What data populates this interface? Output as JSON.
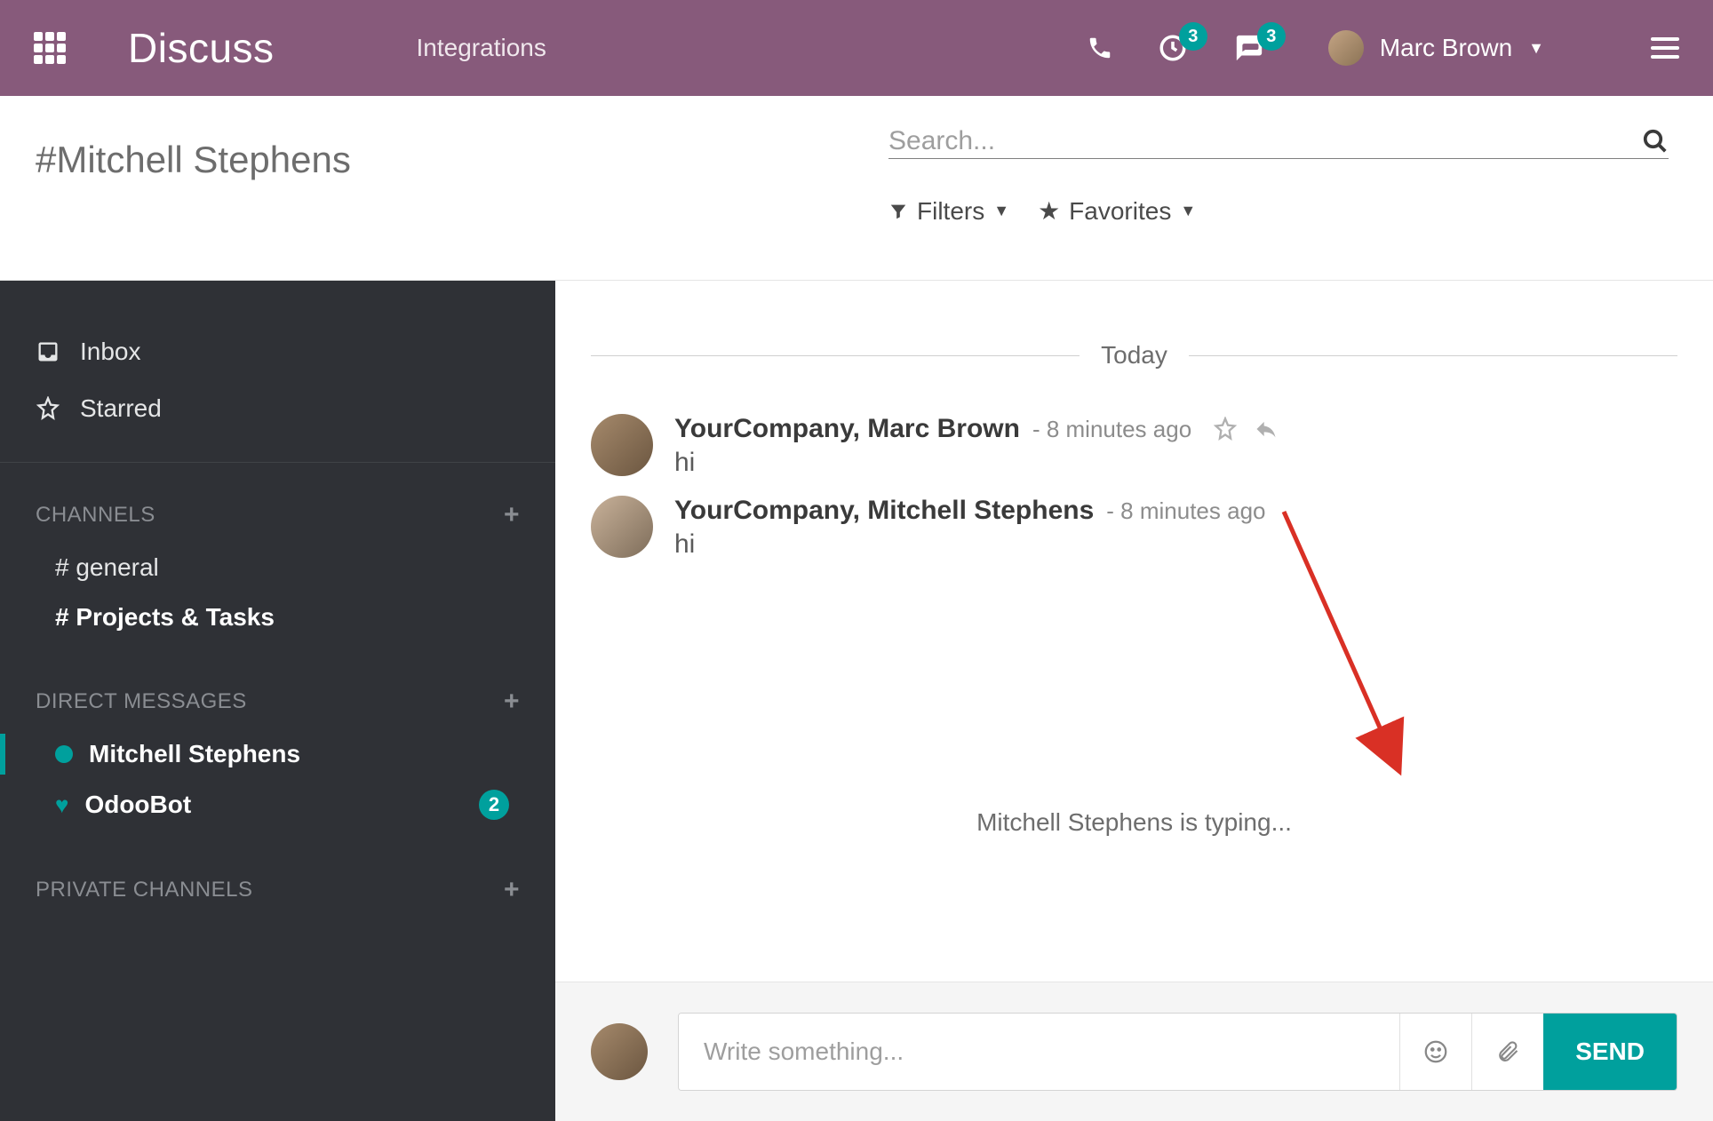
{
  "topbar": {
    "brand": "Discuss",
    "nav": {
      "integrations": "Integrations"
    },
    "activity_badge": "3",
    "messages_badge": "3",
    "user_name": "Marc Brown"
  },
  "subheader": {
    "channel_title": "#Mitchell Stephens",
    "search_placeholder": "Search...",
    "filters_label": "Filters",
    "favorites_label": "Favorites"
  },
  "sidebar": {
    "inbox": "Inbox",
    "starred": "Starred",
    "channels_header": "CHANNELS",
    "channels": [
      {
        "label": "# general",
        "bold": false
      },
      {
        "label": "# Projects & Tasks",
        "bold": true
      }
    ],
    "dm_header": "DIRECT MESSAGES",
    "dms": [
      {
        "label": "Mitchell Stephens",
        "badge": "",
        "icon": "dot",
        "active": true
      },
      {
        "label": "OdooBot",
        "badge": "2",
        "icon": "heart",
        "active": false
      }
    ],
    "private_header": "PRIVATE CHANNELS"
  },
  "thread": {
    "day_separator": "Today",
    "messages": [
      {
        "author": "YourCompany, Marc Brown",
        "time": "8 minutes ago",
        "body": "hi",
        "show_actions": true
      },
      {
        "author": "YourCompany, Mitchell Stephens",
        "time": "8 minutes ago",
        "body": "hi",
        "show_actions": false
      }
    ],
    "typing": "Mitchell Stephens is typing..."
  },
  "composer": {
    "placeholder": "Write something...",
    "send_label": "SEND"
  }
}
